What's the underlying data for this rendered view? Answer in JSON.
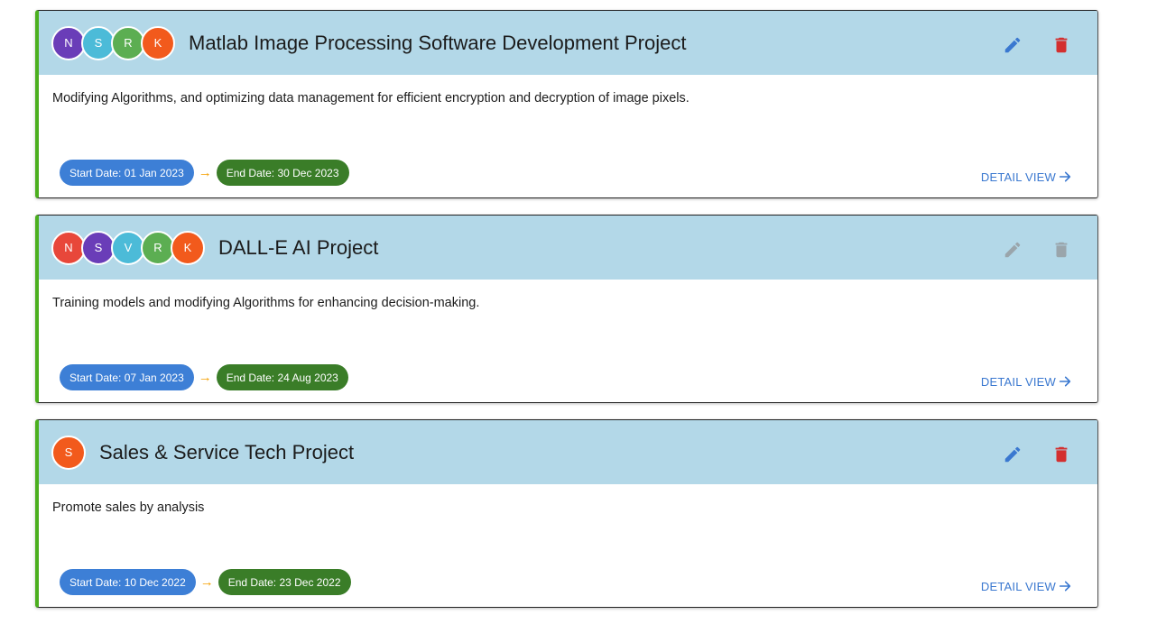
{
  "projects": [
    {
      "title": "Matlab Image Processing Software Development Project",
      "description": "Modifying Algorithms, and optimizing data management for efficient encryption and decryption of image pixels.",
      "members": [
        {
          "initial": "N",
          "color": "#6a3db8"
        },
        {
          "initial": "S",
          "color": "#4cbbd8"
        },
        {
          "initial": "R",
          "color": "#5cae52"
        },
        {
          "initial": "K",
          "color": "#f25a1c"
        }
      ],
      "start_date": "Start Date: 01 Jan 2023",
      "end_date": "End Date: 30 Dec 2023",
      "detail_label": "DETAIL VIEW",
      "actions_enabled": true
    },
    {
      "title": "DALL-E AI Project",
      "description": "Training models and modifying Algorithms for enhancing decision-making.",
      "members": [
        {
          "initial": "N",
          "color": "#e8473a"
        },
        {
          "initial": "S",
          "color": "#6a3db8"
        },
        {
          "initial": "V",
          "color": "#4cbbd8"
        },
        {
          "initial": "R",
          "color": "#5cae52"
        },
        {
          "initial": "K",
          "color": "#f25a1c"
        }
      ],
      "start_date": "Start Date: 07 Jan 2023",
      "end_date": "End Date: 24 Aug 2023",
      "detail_label": "DETAIL VIEW",
      "actions_enabled": false
    },
    {
      "title": "Sales & Service Tech Project",
      "description": "Promote sales by analysis",
      "members": [
        {
          "initial": "S",
          "color": "#f25a1c"
        }
      ],
      "start_date": "Start Date: 10 Dec 2022",
      "end_date": "End Date: 23 Dec 2022",
      "detail_label": "DETAIL VIEW",
      "actions_enabled": true
    }
  ],
  "colors": {
    "edit_active": "#3a78d0",
    "delete_active": "#d32f2f",
    "disabled": "#9aa5ab"
  },
  "icons": {
    "edit": "pencil-icon",
    "delete": "trash-icon",
    "detail": "arrow-right-icon",
    "date_separator": "→"
  }
}
